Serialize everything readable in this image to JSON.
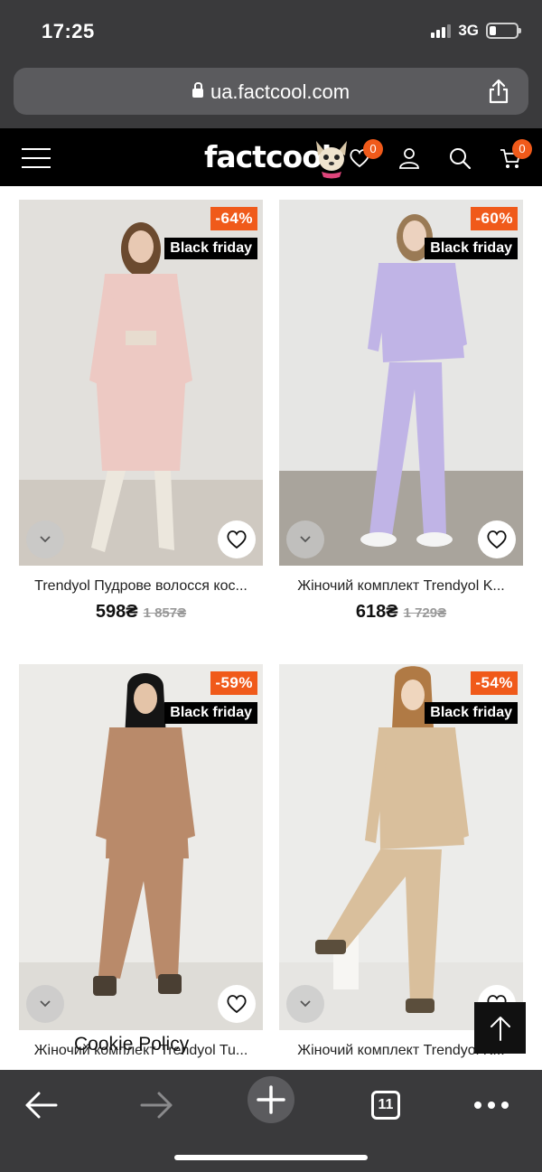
{
  "status_bar": {
    "time": "17:25",
    "network": "3G"
  },
  "browser": {
    "url": "ua.factcool.com",
    "tabs_count": "11"
  },
  "site_header": {
    "logo_text": "factcool",
    "wishlist_count": "0",
    "cart_count": "0"
  },
  "products": [
    {
      "title": "Trendyol Пудрове волосся кос...",
      "price": "598₴",
      "old_price": "1 857₴",
      "discount": "-64%",
      "tag": "Black friday",
      "colors": {
        "bg": "#e2e0dc",
        "floor": "#cfc9c1",
        "cloth": "#edc9c3",
        "hair": "#6b4a2f",
        "boots": "#ece7dd"
      }
    },
    {
      "title": "Жіночий комплект Trendyol K...",
      "price": "618₴",
      "old_price": "1 729₴",
      "discount": "-60%",
      "tag": "Black friday",
      "colors": {
        "bg": "#e6e6e4",
        "floor": "#a9a49c",
        "cloth": "#c0b4e6",
        "hair": "#9a7a55",
        "boots": "#f4f4f4"
      }
    },
    {
      "title": "Жіночий комплект Trendyol Tu...",
      "price": "",
      "old_price": "",
      "discount": "-59%",
      "tag": "Black friday",
      "colors": {
        "bg": "#ecebe8",
        "floor": "#dedcd7",
        "cloth": "#b98a6a",
        "hair": "#151515",
        "boots": "#4a3f33"
      }
    },
    {
      "title": "Жіночий комплект Trendyol K...",
      "price": "",
      "old_price": "",
      "discount": "-54%",
      "tag": "Black friday",
      "colors": {
        "bg": "#ececea",
        "floor": "#e6e5e2",
        "cloth": "#d9bf9c",
        "hair": "#b07a45",
        "boots": "#5b4e3c"
      }
    }
  ],
  "cookie_policy": "Cookie Policy"
}
